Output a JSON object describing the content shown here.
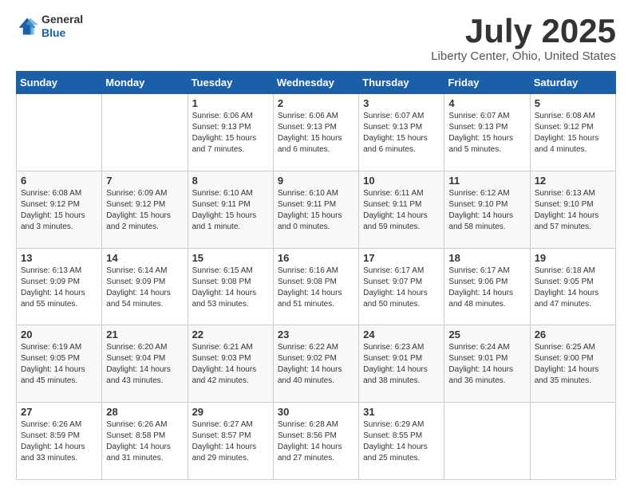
{
  "header": {
    "logo": {
      "line1": "General",
      "line2": "Blue"
    },
    "title": "July 2025",
    "location": "Liberty Center, Ohio, United States"
  },
  "weekdays": [
    "Sunday",
    "Monday",
    "Tuesday",
    "Wednesday",
    "Thursday",
    "Friday",
    "Saturday"
  ],
  "weeks": [
    [
      {
        "day": "",
        "content": ""
      },
      {
        "day": "",
        "content": ""
      },
      {
        "day": "1",
        "content": "Sunrise: 6:06 AM\nSunset: 9:13 PM\nDaylight: 15 hours\nand 7 minutes."
      },
      {
        "day": "2",
        "content": "Sunrise: 6:06 AM\nSunset: 9:13 PM\nDaylight: 15 hours\nand 6 minutes."
      },
      {
        "day": "3",
        "content": "Sunrise: 6:07 AM\nSunset: 9:13 PM\nDaylight: 15 hours\nand 6 minutes."
      },
      {
        "day": "4",
        "content": "Sunrise: 6:07 AM\nSunset: 9:13 PM\nDaylight: 15 hours\nand 5 minutes."
      },
      {
        "day": "5",
        "content": "Sunrise: 6:08 AM\nSunset: 9:12 PM\nDaylight: 15 hours\nand 4 minutes."
      }
    ],
    [
      {
        "day": "6",
        "content": "Sunrise: 6:08 AM\nSunset: 9:12 PM\nDaylight: 15 hours\nand 3 minutes."
      },
      {
        "day": "7",
        "content": "Sunrise: 6:09 AM\nSunset: 9:12 PM\nDaylight: 15 hours\nand 2 minutes."
      },
      {
        "day": "8",
        "content": "Sunrise: 6:10 AM\nSunset: 9:11 PM\nDaylight: 15 hours\nand 1 minute."
      },
      {
        "day": "9",
        "content": "Sunrise: 6:10 AM\nSunset: 9:11 PM\nDaylight: 15 hours\nand 0 minutes."
      },
      {
        "day": "10",
        "content": "Sunrise: 6:11 AM\nSunset: 9:11 PM\nDaylight: 14 hours\nand 59 minutes."
      },
      {
        "day": "11",
        "content": "Sunrise: 6:12 AM\nSunset: 9:10 PM\nDaylight: 14 hours\nand 58 minutes."
      },
      {
        "day": "12",
        "content": "Sunrise: 6:13 AM\nSunset: 9:10 PM\nDaylight: 14 hours\nand 57 minutes."
      }
    ],
    [
      {
        "day": "13",
        "content": "Sunrise: 6:13 AM\nSunset: 9:09 PM\nDaylight: 14 hours\nand 55 minutes."
      },
      {
        "day": "14",
        "content": "Sunrise: 6:14 AM\nSunset: 9:09 PM\nDaylight: 14 hours\nand 54 minutes."
      },
      {
        "day": "15",
        "content": "Sunrise: 6:15 AM\nSunset: 9:08 PM\nDaylight: 14 hours\nand 53 minutes."
      },
      {
        "day": "16",
        "content": "Sunrise: 6:16 AM\nSunset: 9:08 PM\nDaylight: 14 hours\nand 51 minutes."
      },
      {
        "day": "17",
        "content": "Sunrise: 6:17 AM\nSunset: 9:07 PM\nDaylight: 14 hours\nand 50 minutes."
      },
      {
        "day": "18",
        "content": "Sunrise: 6:17 AM\nSunset: 9:06 PM\nDaylight: 14 hours\nand 48 minutes."
      },
      {
        "day": "19",
        "content": "Sunrise: 6:18 AM\nSunset: 9:05 PM\nDaylight: 14 hours\nand 47 minutes."
      }
    ],
    [
      {
        "day": "20",
        "content": "Sunrise: 6:19 AM\nSunset: 9:05 PM\nDaylight: 14 hours\nand 45 minutes."
      },
      {
        "day": "21",
        "content": "Sunrise: 6:20 AM\nSunset: 9:04 PM\nDaylight: 14 hours\nand 43 minutes."
      },
      {
        "day": "22",
        "content": "Sunrise: 6:21 AM\nSunset: 9:03 PM\nDaylight: 14 hours\nand 42 minutes."
      },
      {
        "day": "23",
        "content": "Sunrise: 6:22 AM\nSunset: 9:02 PM\nDaylight: 14 hours\nand 40 minutes."
      },
      {
        "day": "24",
        "content": "Sunrise: 6:23 AM\nSunset: 9:01 PM\nDaylight: 14 hours\nand 38 minutes."
      },
      {
        "day": "25",
        "content": "Sunrise: 6:24 AM\nSunset: 9:01 PM\nDaylight: 14 hours\nand 36 minutes."
      },
      {
        "day": "26",
        "content": "Sunrise: 6:25 AM\nSunset: 9:00 PM\nDaylight: 14 hours\nand 35 minutes."
      }
    ],
    [
      {
        "day": "27",
        "content": "Sunrise: 6:26 AM\nSunset: 8:59 PM\nDaylight: 14 hours\nand 33 minutes."
      },
      {
        "day": "28",
        "content": "Sunrise: 6:26 AM\nSunset: 8:58 PM\nDaylight: 14 hours\nand 31 minutes."
      },
      {
        "day": "29",
        "content": "Sunrise: 6:27 AM\nSunset: 8:57 PM\nDaylight: 14 hours\nand 29 minutes."
      },
      {
        "day": "30",
        "content": "Sunrise: 6:28 AM\nSunset: 8:56 PM\nDaylight: 14 hours\nand 27 minutes."
      },
      {
        "day": "31",
        "content": "Sunrise: 6:29 AM\nSunset: 8:55 PM\nDaylight: 14 hours\nand 25 minutes."
      },
      {
        "day": "",
        "content": ""
      },
      {
        "day": "",
        "content": ""
      }
    ]
  ]
}
